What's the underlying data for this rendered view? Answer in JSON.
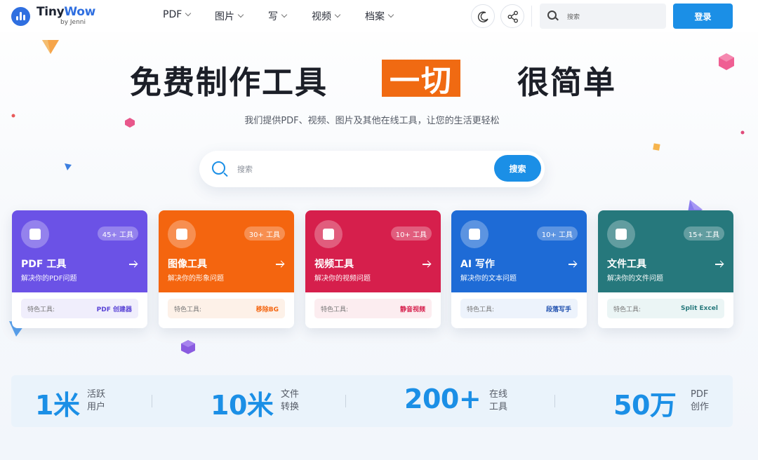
{
  "header": {
    "logo_name_a": "Tiny",
    "logo_name_b": "Wow",
    "logo_by": "by Jenni",
    "nav": [
      "PDF",
      "图片",
      "写",
      "视频",
      "档案"
    ],
    "search_placeholder": "搜索",
    "login_label": "登录",
    "icons": [
      "moon-icon",
      "share-icon",
      "search-icon"
    ]
  },
  "hero": {
    "title_left": "免费制作工具",
    "title_highlight": "一切",
    "title_right": "很简单",
    "subtitle": "我们提供PDF、视频、图片及其他在线工具，让您的生活更轻松",
    "search_placeholder": "搜索",
    "search_button": "搜索",
    "highlight_color": "#f06a12",
    "accent_color": "#1b8fe6"
  },
  "cards": [
    {
      "title": "PDF 工具",
      "desc": "解决你的PDF问题",
      "badge": "45+ 工具",
      "feature_label": "特色工具:",
      "feature_value": "PDF 创建器",
      "color": "#6b52e6",
      "feature_color": "#5b45d6",
      "feature_bg": "#f0eefc",
      "icon": "document-icon"
    },
    {
      "title": "图像工具",
      "desc": "解决你的形象问题",
      "badge": "30+ 工具",
      "feature_label": "特色工具:",
      "feature_value": "移除BG",
      "color": "#f4650f",
      "feature_color": "#f4650f",
      "feature_bg": "#fdf1e8",
      "icon": "image-icon"
    },
    {
      "title": "视频工具",
      "desc": "解决你的视频问题",
      "badge": "10+ 工具",
      "feature_label": "特色工具:",
      "feature_value": "静音视频",
      "color": "#d61f4c",
      "feature_color": "#d61f4c",
      "feature_bg": "#fcedf0",
      "icon": "video-icon"
    },
    {
      "title": "AI 写作",
      "desc": "解决你的文本问题",
      "badge": "10+ 工具",
      "feature_label": "特色工具:",
      "feature_value": "段落写手",
      "color": "#1e6bd6",
      "feature_color": "#1e4fae",
      "feature_bg": "#edf3fc",
      "icon": "chat-icon"
    },
    {
      "title": "文件工具",
      "desc": "解决你的文件问题",
      "badge": "15+ 工具",
      "feature_label": "特色工具:",
      "feature_value": "Split Excel",
      "color": "#26787c",
      "feature_color": "#26787c",
      "feature_bg": "#ebf5f5",
      "icon": "files-icon"
    }
  ],
  "stats": [
    {
      "value": "1米",
      "label": "活跃 用户"
    },
    {
      "value": "10米",
      "label": "文件 转换"
    },
    {
      "value": "200+",
      "label": "在线 工具"
    },
    {
      "value": "50万",
      "label": "PDF 创作"
    }
  ]
}
